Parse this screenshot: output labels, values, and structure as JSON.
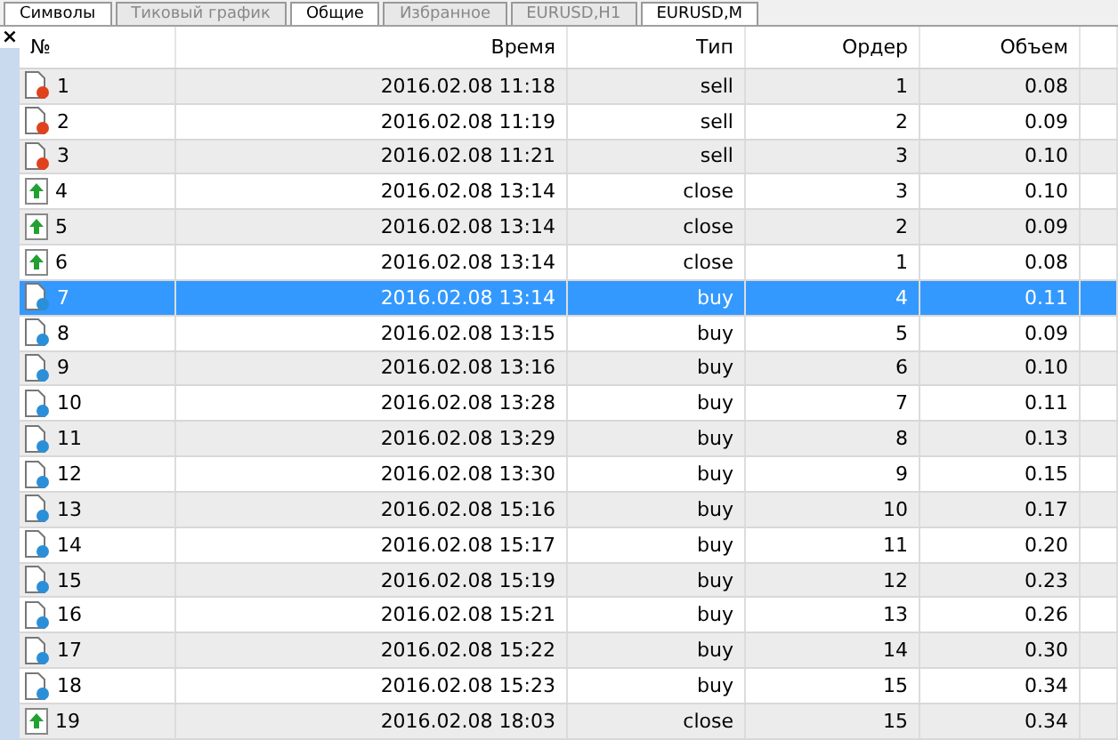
{
  "top_tabs": [
    {
      "label": "Символы",
      "selected": true
    },
    {
      "label": "Тиковый график",
      "selected": false
    },
    {
      "label": "Общие",
      "selected": true
    },
    {
      "label": "Избранное",
      "selected": false
    },
    {
      "label": "EURUSD,H1",
      "selected": false
    },
    {
      "label": "EURUSD,M",
      "selected": true
    }
  ],
  "close_label": "×",
  "table": {
    "columns": [
      "№",
      "Время",
      "Тип",
      "Ордер",
      "Объем"
    ],
    "rows": [
      {
        "kind": "sell",
        "n": "1",
        "time": "2016.02.08 11:18",
        "type": "sell",
        "order": "1",
        "volume": "0.08",
        "selected": false
      },
      {
        "kind": "sell",
        "n": "2",
        "time": "2016.02.08 11:19",
        "type": "sell",
        "order": "2",
        "volume": "0.09",
        "selected": false
      },
      {
        "kind": "sell",
        "n": "3",
        "time": "2016.02.08 11:21",
        "type": "sell",
        "order": "3",
        "volume": "0.10",
        "selected": false
      },
      {
        "kind": "close",
        "n": "4",
        "time": "2016.02.08 13:14",
        "type": "close",
        "order": "3",
        "volume": "0.10",
        "selected": false
      },
      {
        "kind": "close",
        "n": "5",
        "time": "2016.02.08 13:14",
        "type": "close",
        "order": "2",
        "volume": "0.09",
        "selected": false
      },
      {
        "kind": "close",
        "n": "6",
        "time": "2016.02.08 13:14",
        "type": "close",
        "order": "1",
        "volume": "0.08",
        "selected": false
      },
      {
        "kind": "buy",
        "n": "7",
        "time": "2016.02.08 13:14",
        "type": "buy",
        "order": "4",
        "volume": "0.11",
        "selected": true
      },
      {
        "kind": "buy",
        "n": "8",
        "time": "2016.02.08 13:15",
        "type": "buy",
        "order": "5",
        "volume": "0.09",
        "selected": false
      },
      {
        "kind": "buy",
        "n": "9",
        "time": "2016.02.08 13:16",
        "type": "buy",
        "order": "6",
        "volume": "0.10",
        "selected": false
      },
      {
        "kind": "buy",
        "n": "10",
        "time": "2016.02.08 13:28",
        "type": "buy",
        "order": "7",
        "volume": "0.11",
        "selected": false
      },
      {
        "kind": "buy",
        "n": "11",
        "time": "2016.02.08 13:29",
        "type": "buy",
        "order": "8",
        "volume": "0.13",
        "selected": false
      },
      {
        "kind": "buy",
        "n": "12",
        "time": "2016.02.08 13:30",
        "type": "buy",
        "order": "9",
        "volume": "0.15",
        "selected": false
      },
      {
        "kind": "buy",
        "n": "13",
        "time": "2016.02.08 15:16",
        "type": "buy",
        "order": "10",
        "volume": "0.17",
        "selected": false
      },
      {
        "kind": "buy",
        "n": "14",
        "time": "2016.02.08 15:17",
        "type": "buy",
        "order": "11",
        "volume": "0.20",
        "selected": false
      },
      {
        "kind": "buy",
        "n": "15",
        "time": "2016.02.08 15:19",
        "type": "buy",
        "order": "12",
        "volume": "0.23",
        "selected": false
      },
      {
        "kind": "buy",
        "n": "16",
        "time": "2016.02.08 15:21",
        "type": "buy",
        "order": "13",
        "volume": "0.26",
        "selected": false
      },
      {
        "kind": "buy",
        "n": "17",
        "time": "2016.02.08 15:22",
        "type": "buy",
        "order": "14",
        "volume": "0.30",
        "selected": false
      },
      {
        "kind": "buy",
        "n": "18",
        "time": "2016.02.08 15:23",
        "type": "buy",
        "order": "15",
        "volume": "0.34",
        "selected": false
      },
      {
        "kind": "close",
        "n": "19",
        "time": "2016.02.08 18:03",
        "type": "close",
        "order": "15",
        "volume": "0.34",
        "selected": false
      }
    ]
  }
}
